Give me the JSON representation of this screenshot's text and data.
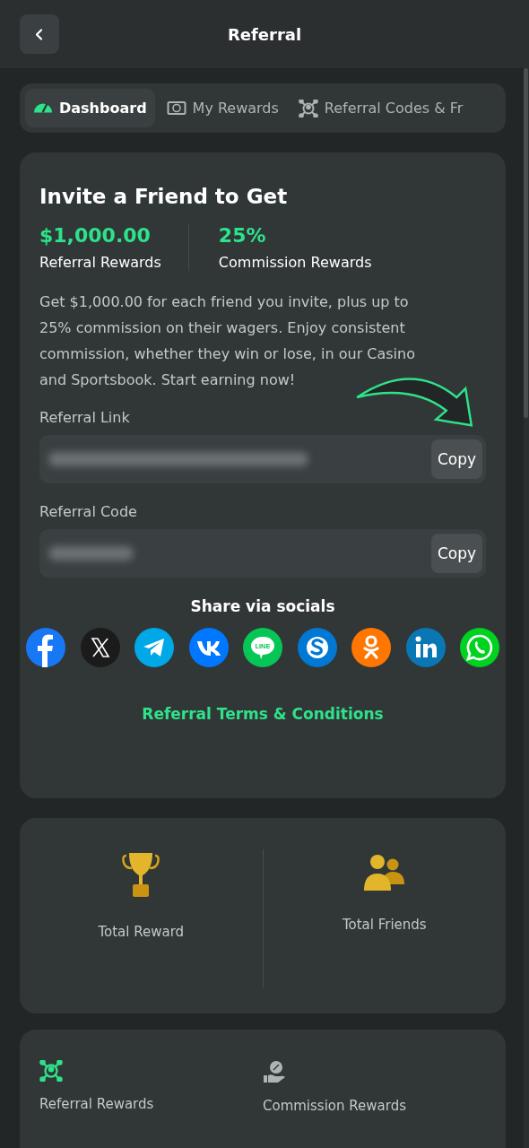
{
  "header": {
    "title": "Referral"
  },
  "tabs": [
    {
      "label": "Dashboard",
      "kind": "gauge",
      "selected": true
    },
    {
      "label": "My Rewards",
      "kind": "money",
      "selected": false
    },
    {
      "label": "Referral Codes & Fr",
      "kind": "network",
      "selected": false
    }
  ],
  "invite": {
    "title": "Invite a Friend to Get",
    "stats": [
      {
        "value": "$1,000.00",
        "label": "Referral Rewards"
      },
      {
        "value": "25%",
        "label": "Commission Rewards"
      }
    ],
    "description": "Get $1,000.00 for each friend you invite, plus up to 25% commission on their wagers. Enjoy consistent commission, whether they win or lose, in our Casino and Sportsbook. Start earning now!",
    "fields": [
      {
        "label": "Referral Link",
        "button": "Copy"
      },
      {
        "label": "Referral Code",
        "button": "Copy"
      }
    ],
    "share_title": "Share via socials",
    "socials": [
      {
        "kind": "facebook",
        "color": "#1877f2"
      },
      {
        "kind": "x",
        "color": "#1b1b1b"
      },
      {
        "kind": "telegram",
        "color": "#00a8e8"
      },
      {
        "kind": "vk",
        "color": "#0077ff"
      },
      {
        "kind": "line",
        "color": "#06c755",
        "label": "LINE"
      },
      {
        "kind": "skype",
        "color": "#0078d4"
      },
      {
        "kind": "ok",
        "color": "#ff7700"
      },
      {
        "kind": "linkedin",
        "color": "#0a77b5"
      },
      {
        "kind": "whatsapp",
        "color": "#00d220"
      }
    ],
    "terms_link": "Referral Terms & Conditions"
  },
  "totals": [
    {
      "label": "Total Reward",
      "kind": "trophy"
    },
    {
      "label": "Total Friends",
      "kind": "friends"
    }
  ],
  "reward_tabs": [
    {
      "label": "Referral Rewards",
      "kind": "network",
      "selected": true
    },
    {
      "label": "Commission Rewards",
      "kind": "hand",
      "selected": false
    }
  ]
}
